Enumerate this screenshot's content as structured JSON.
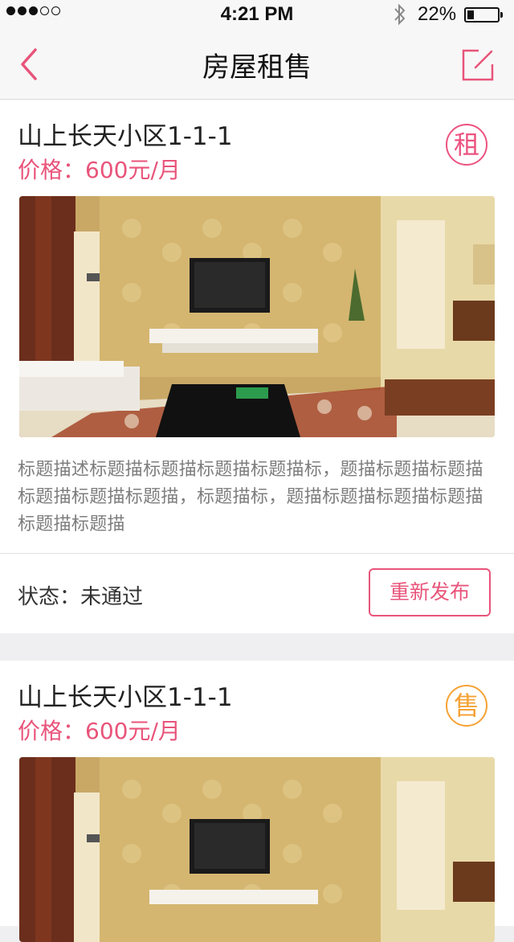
{
  "status_bar": {
    "time": "4:21 PM",
    "battery_text": "22%",
    "battery_level": 0.22,
    "signal_bars_filled": 3,
    "signal_bars_total": 5,
    "bluetooth_icon": "bluetooth-icon"
  },
  "nav": {
    "title": "房屋租售",
    "back_icon": "chevron-left-icon",
    "edit_icon": "edit-icon",
    "accent": "#e8547a"
  },
  "listings": [
    {
      "name": "山上长天小区1-1-1",
      "price": "价格：600元/月",
      "badge": "租",
      "badge_color": "#ec5380",
      "description": "标题描述标题描标题描标题描标题描标，题描标题描标题描标题描标题描标题描，标题描标，题描标题描标题描标题描标题描标题描",
      "status": "状态：未通过",
      "action": "重新发布"
    },
    {
      "name": "山上长天小区1-1-1",
      "price": "价格：600元/月",
      "badge": "售",
      "badge_color": "#f6a235"
    }
  ]
}
